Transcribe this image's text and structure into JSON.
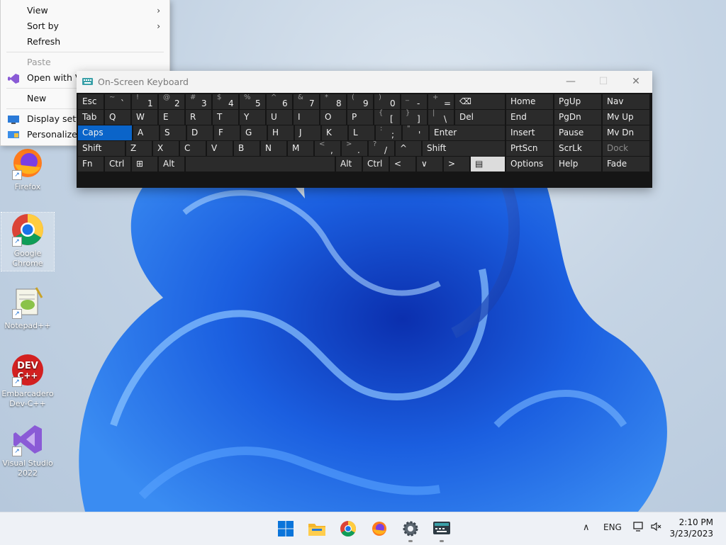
{
  "context_menu": {
    "items": [
      {
        "label": "View",
        "has_submenu": true
      },
      {
        "label": "Sort by",
        "has_submenu": true
      },
      {
        "label": "Refresh"
      },
      {
        "label": "Paste",
        "disabled": true
      },
      {
        "label": "Open with Vis"
      },
      {
        "label": "New"
      },
      {
        "label": "Display settin"
      },
      {
        "label": "Personalize"
      }
    ]
  },
  "desktop_icons": [
    {
      "label": "Firefox",
      "icon": "firefox-icon"
    },
    {
      "label": "Google Chrome",
      "icon": "chrome-icon"
    },
    {
      "label": "Notepad++",
      "icon": "notepadpp-icon"
    },
    {
      "label": "Embarcadero Dev-C++",
      "icon": "devcpp-icon"
    },
    {
      "label": "Visual Studio 2022",
      "icon": "visual-studio-icon"
    }
  ],
  "osk": {
    "title": "On-Screen Keyboard",
    "rows": {
      "r1": [
        "Esc",
        "~ `",
        "! 1",
        "@ 2",
        "# 3",
        "$ 4",
        "% 5",
        "^ 6",
        "& 7",
        "* 8",
        "( 9",
        ") 0",
        "_ -",
        "+ =",
        "⌫",
        "Home",
        "PgUp",
        "Nav"
      ],
      "r2": [
        "Tab",
        "Q",
        "W",
        "E",
        "R",
        "T",
        "Y",
        "U",
        "I",
        "O",
        "P",
        "{ [",
        "} ]",
        "| \\",
        "Del",
        "End",
        "PgDn",
        "Mv Up"
      ],
      "r3": [
        "Caps",
        "A",
        "S",
        "D",
        "F",
        "G",
        "H",
        "J",
        "K",
        "L",
        ": ;",
        "\" '",
        "Enter",
        "Insert",
        "Pause",
        "Mv Dn"
      ],
      "r4": [
        "Shift",
        "Z",
        "X",
        "C",
        "V",
        "B",
        "N",
        "M",
        "< ,",
        "> .",
        "? /",
        "^",
        "Shift",
        "PrtScn",
        "ScrLk",
        "Dock"
      ],
      "r5": [
        "Fn",
        "Ctrl",
        "⊞",
        "Alt",
        "",
        "Alt",
        "Ctrl",
        "<",
        "∨",
        ">",
        "▤",
        "Options",
        "Help",
        "Fade"
      ]
    },
    "active_key": "Caps",
    "disabled_key": "Dock"
  },
  "taskbar": {
    "apps": [
      "start-icon",
      "file-explorer-icon",
      "chrome-icon",
      "firefox-icon",
      "settings-icon",
      "osk-icon"
    ],
    "tray": {
      "language": "ENG"
    },
    "clock": {
      "time": "2:10 PM",
      "date": "3/23/2023"
    }
  }
}
